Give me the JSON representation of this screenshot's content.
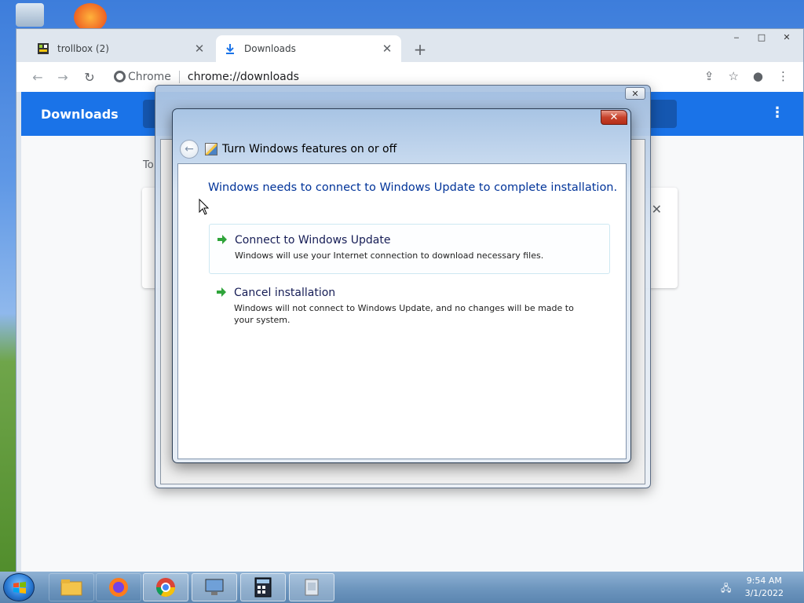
{
  "chrome": {
    "tabs": [
      {
        "label": "trollbox (2)",
        "active": false,
        "icon": "trollbox-favicon"
      },
      {
        "label": "Downloads",
        "active": true,
        "icon": "download-icon"
      }
    ],
    "new_tab": "+",
    "window_controls": {
      "minimize": "‒",
      "maximize": "□",
      "close": "✕"
    },
    "omnibox": {
      "secure_label": "Chrome",
      "url": "chrome://downloads"
    },
    "page": {
      "title": "Downloads",
      "today_label": "To"
    }
  },
  "dialog": {
    "close": "✕",
    "header_title": "Turn Windows features on or off",
    "instruction": "Windows needs to connect to Windows Update to complete installation.",
    "options": [
      {
        "title": "Connect to Windows Update",
        "description": "Windows will use your Internet connection to download necessary files."
      },
      {
        "title": "Cancel installation",
        "description": "Windows will not connect to Windows Update, and no changes will be made to your system."
      }
    ]
  },
  "outer_dialog": {
    "close": "✕"
  },
  "taskbar": {
    "apps": [
      "file-explorer-icon",
      "firefox-icon",
      "chrome-icon",
      "computer-management-icon",
      "calculator-icon",
      "installer-icon"
    ],
    "clock": {
      "time": "9:54 AM",
      "date": "3/1/2022"
    }
  },
  "colors": {
    "chrome_blue": "#1a73e8",
    "instruction_blue": "#003399",
    "command_title": "#151c55",
    "arrow_green": "#2fa43a"
  }
}
